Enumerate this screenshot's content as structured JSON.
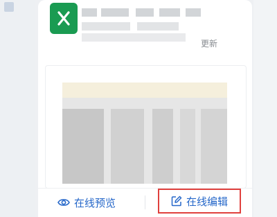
{
  "file_card": {
    "icon": "excel-file-icon",
    "icon_color": "#1a9b52",
    "updated_label": "更新"
  },
  "actions": {
    "preview_label": "在线预览",
    "edit_label": "在线编辑",
    "accent_color": "#2567c9",
    "highlight_color": "#e0403d"
  }
}
